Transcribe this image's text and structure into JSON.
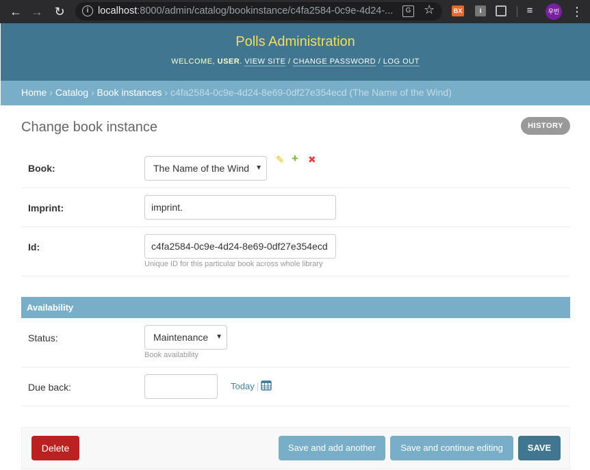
{
  "browser": {
    "url_host": "localhost",
    "url_rest": ":8000/admin/catalog/bookinstance/c4fa2584-0c9e-4d24-...",
    "avatar_text": "우빈",
    "ext1_text": "BX",
    "ext2_text": "I"
  },
  "header": {
    "site_name": "Polls Administration",
    "welcome": "Welcome, ",
    "user": "user",
    "view_site": "View site",
    "change_password": "Change password",
    "log_out": "Log out"
  },
  "breadcrumbs": {
    "home": "Home",
    "catalog": "Catalog",
    "book_instances": "Book instances",
    "current": "c4fa2584-0c9e-4d24-8e69-0df27e354ecd (The Name of the Wind)"
  },
  "page": {
    "title": "Change book instance",
    "history": "History"
  },
  "form": {
    "book_label": "Book:",
    "book_value": "The Name of the Wind",
    "imprint_label": "Imprint:",
    "imprint_value": "imprint.",
    "id_label": "Id:",
    "id_value": "c4fa2584-0c9e-4d24-8e69-0df27e354ecd",
    "id_help": "Unique ID for this particular book across whole library"
  },
  "availability": {
    "heading": "Availability",
    "status_label": "Status:",
    "status_value": "Maintenance",
    "status_help": "Book availability",
    "due_back_label": "Due back:",
    "due_back_value": "",
    "today": "Today",
    "separator": "|"
  },
  "actions": {
    "delete": "Delete",
    "save_add_another": "Save and add another",
    "save_continue": "Save and continue editing",
    "save": "SAVE"
  },
  "colors": {
    "header_bg": "#417690",
    "breadcrumb_bg": "#79aec8",
    "site_name": "#f5dd5d",
    "delete_red": "#ba2121"
  }
}
